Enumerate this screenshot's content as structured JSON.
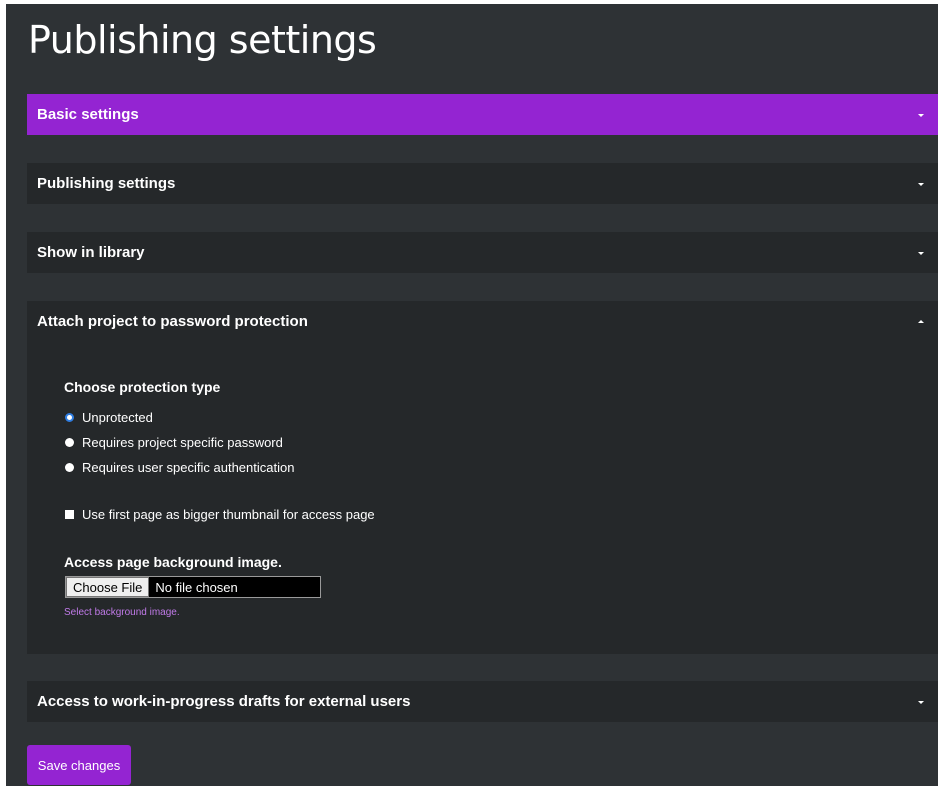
{
  "page": {
    "title": "Publishing settings"
  },
  "accordion": [
    {
      "label": "Basic settings",
      "state": "collapsed"
    },
    {
      "label": "Publishing settings",
      "state": "collapsed"
    },
    {
      "label": "Show in library",
      "state": "collapsed"
    },
    {
      "label": "Attach project to password protection",
      "state": "expanded"
    },
    {
      "label": "Access to work-in-progress drafts for external users",
      "state": "collapsed"
    }
  ],
  "protection": {
    "heading": "Choose protection type",
    "options": [
      {
        "label": "Unprotected",
        "selected": true
      },
      {
        "label": "Requires project specific password",
        "selected": false
      },
      {
        "label": "Requires user specific authentication",
        "selected": false
      }
    ],
    "thumbnail_checkbox": {
      "label": "Use first page as bigger thumbnail for access page",
      "checked": false
    },
    "background_image": {
      "label": "Access page background image.",
      "button_label": "Choose File",
      "status": "No file chosen",
      "hint": "Select background image."
    }
  },
  "actions": {
    "save_label": "Save changes"
  },
  "colors": {
    "accent": "#9424d2",
    "panel": "#2e3235",
    "section": "#25282a",
    "hint": "#c07ae8"
  }
}
